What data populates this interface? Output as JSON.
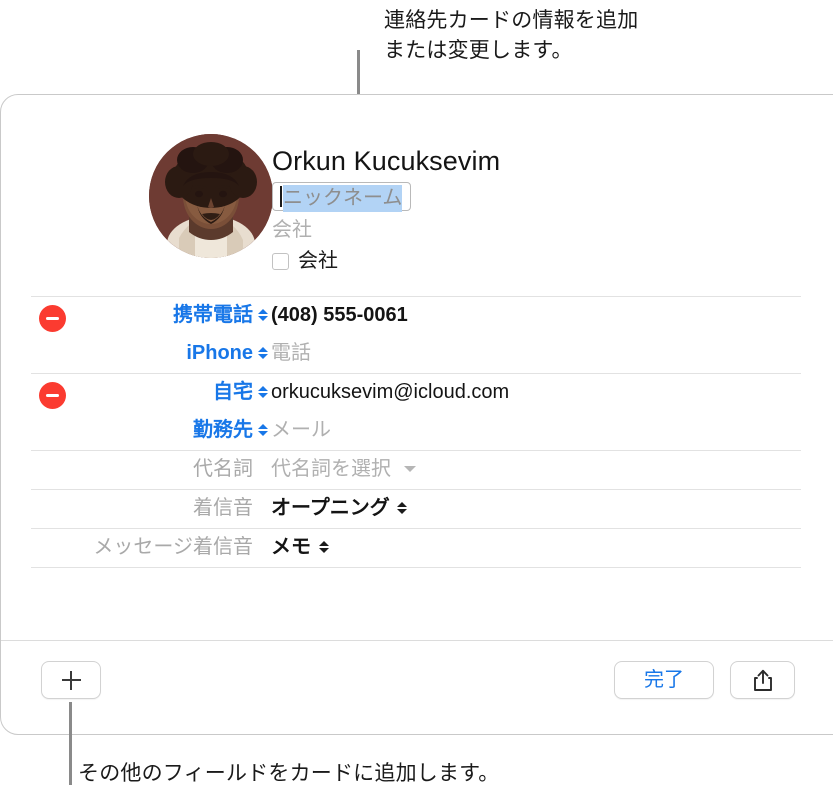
{
  "callouts": {
    "top": "連絡先カードの情報を追加\nまたは変更します。",
    "bottom": "その他のフィールドをカードに追加します。"
  },
  "card": {
    "contact_name": "Orkun Kucuksevim",
    "nickname_placeholder": "ニックネーム",
    "company_placeholder": "会社",
    "company_checkbox_label": "会社",
    "avatar_alt": "contact-photo"
  },
  "fields": [
    {
      "label": "携帯電話",
      "label_style": "blue",
      "has_remove": true,
      "has_stepper": true,
      "value": "(408) 555-0061",
      "value_style": "dark"
    },
    {
      "label": "iPhone",
      "label_style": "blue",
      "has_remove": false,
      "has_stepper": true,
      "value": "電話",
      "value_style": "gray"
    },
    {
      "label": "自宅",
      "label_style": "blue",
      "has_remove": true,
      "has_stepper": true,
      "value": "orkucuksevim@icloud.com",
      "value_style": "normal"
    },
    {
      "label": "勤務先",
      "label_style": "blue",
      "has_remove": false,
      "has_stepper": true,
      "value": "メール",
      "value_style": "gray"
    },
    {
      "label": "代名詞",
      "label_style": "gray",
      "has_remove": false,
      "has_stepper": false,
      "value": "代名詞を選択",
      "value_style": "gray",
      "trailing_icon": "chevron-down-icon"
    },
    {
      "label": "着信音",
      "label_style": "gray",
      "has_remove": false,
      "has_stepper": false,
      "value": "オープニング",
      "value_style": "dark",
      "trailing_icon": "stepper-icon"
    },
    {
      "label": "メッセージ着信音",
      "label_style": "gray",
      "has_remove": false,
      "has_stepper": false,
      "value": "メモ",
      "value_style": "dark",
      "trailing_icon": "stepper-icon"
    }
  ],
  "toolbar": {
    "add_field_icon": "plus-icon",
    "done_label": "完了",
    "share_icon": "share-icon"
  },
  "colors": {
    "accent_blue": "#1877e8",
    "remove_red": "#fb3b30",
    "selection_blue": "#b2d3f5",
    "placeholder_gray": "#b0b0b0"
  }
}
